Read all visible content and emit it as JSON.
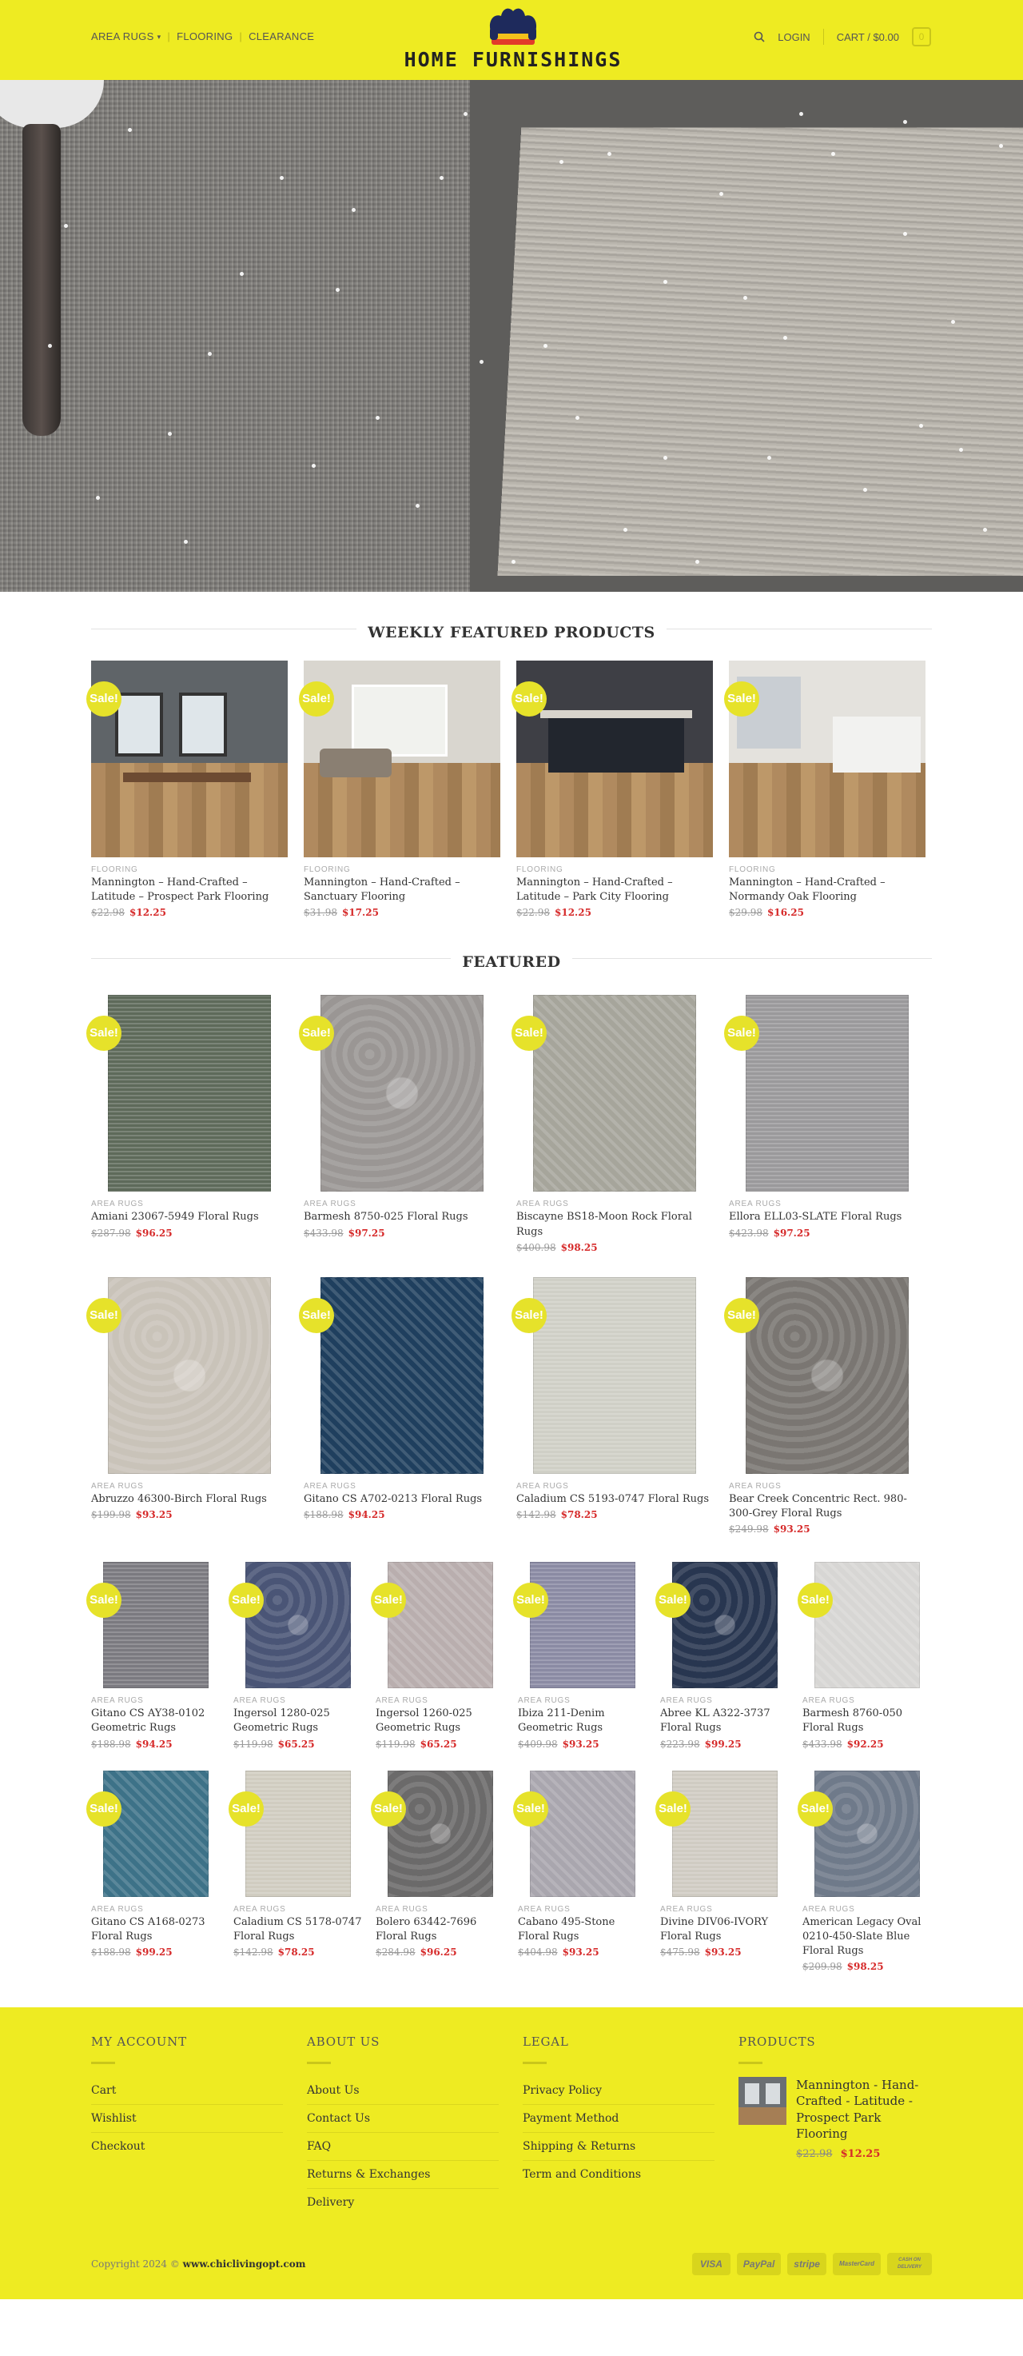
{
  "header": {
    "nav_left": [
      "AREA RUGS",
      "FLOORING",
      "CLEARANCE"
    ],
    "logo_text": "HOME FURNISHINGS",
    "login": "LOGIN",
    "cart": "CART / $0.00",
    "cart_count": "0"
  },
  "weekly": {
    "title": "WEEKLY FEATURED PRODUCTS",
    "items": [
      {
        "cat": "FLOORING",
        "name": "Mannington – Hand-Crafted – Latitude – Prospect Park Flooring",
        "old": "$22.98",
        "new": "$12.25",
        "sale": "Sale!"
      },
      {
        "cat": "FLOORING",
        "name": "Mannington – Hand-Crafted – Sanctuary Flooring",
        "old": "$31.98",
        "new": "$17.25",
        "sale": "Sale!"
      },
      {
        "cat": "FLOORING",
        "name": "Mannington – Hand-Crafted – Latitude – Park City Flooring",
        "old": "$22.98",
        "new": "$12.25",
        "sale": "Sale!"
      },
      {
        "cat": "FLOORING",
        "name": "Mannington – Hand-Crafted – Normandy Oak Flooring",
        "old": "$29.98",
        "new": "$16.25",
        "sale": "Sale!"
      }
    ]
  },
  "featured": {
    "title": "FEATURED",
    "row1": [
      {
        "cat": "AREA RUGS",
        "name": "Amiani 23067-5949 Floral Rugs",
        "old": "$287.98",
        "new": "$96.25",
        "sale": "Sale!",
        "color": "#5e6a5a"
      },
      {
        "cat": "AREA RUGS",
        "name": "Barmesh 8750-025 Floral Rugs",
        "old": "$433.98",
        "new": "$97.25",
        "sale": "Sale!",
        "color": "#9a9694"
      },
      {
        "cat": "AREA RUGS",
        "name": "Biscayne BS18-Moon Rock Floral Rugs",
        "old": "$400.98",
        "new": "$98.25",
        "sale": "Sale!",
        "color": "#a6a59b"
      },
      {
        "cat": "AREA RUGS",
        "name": "Ellora ELL03-SLATE Floral Rugs",
        "old": "$423.98",
        "new": "$97.25",
        "sale": "Sale!",
        "color": "#9a999b"
      }
    ],
    "row2": [
      {
        "cat": "AREA RUGS",
        "name": "Abruzzo 46300-Birch Floral Rugs",
        "old": "$199.98",
        "new": "$93.25",
        "sale": "Sale!",
        "color": "#c9c3b9"
      },
      {
        "cat": "AREA RUGS",
        "name": "Gitano CS A702-0213 Floral Rugs",
        "old": "$188.98",
        "new": "$94.25",
        "sale": "Sale!",
        "color": "#1f3f5e"
      },
      {
        "cat": "AREA RUGS",
        "name": "Caladium CS 5193-0747 Floral Rugs",
        "old": "$142.98",
        "new": "$78.25",
        "sale": "Sale!",
        "color": "#cfcfc6"
      },
      {
        "cat": "AREA RUGS",
        "name": "Bear Creek Concentric Rect. 980-300-Grey Floral Rugs",
        "old": "$249.98",
        "new": "$93.25",
        "sale": "Sale!",
        "color": "#7a7672"
      }
    ],
    "row3": [
      {
        "cat": "AREA RUGS",
        "name": "Gitano CS AY38-0102 Geometric Rugs",
        "old": "$188.98",
        "new": "$94.25",
        "sale": "Sale!",
        "color": "#7b7a80"
      },
      {
        "cat": "AREA RUGS",
        "name": "Ingersol 1280-025 Geometric Rugs",
        "old": "$119.98",
        "new": "$65.25",
        "sale": "Sale!",
        "color": "#4a5576"
      },
      {
        "cat": "AREA RUGS",
        "name": "Ingersol 1260-025 Geometric Rugs",
        "old": "$119.98",
        "new": "$65.25",
        "sale": "Sale!",
        "color": "#b9aeae"
      },
      {
        "cat": "AREA RUGS",
        "name": "Ibiza 211-Denim Geometric Rugs",
        "old": "$409.98",
        "new": "$93.25",
        "sale": "Sale!",
        "color": "#8a8aa3"
      },
      {
        "cat": "AREA RUGS",
        "name": "Abree KL A322-3737 Floral Rugs",
        "old": "$223.98",
        "new": "$99.25",
        "sale": "Sale!",
        "color": "#283650"
      },
      {
        "cat": "AREA RUGS",
        "name": "Barmesh 8760-050 Floral Rugs",
        "old": "$433.98",
        "new": "$92.25",
        "sale": "Sale!",
        "color": "#d7d6d4"
      }
    ],
    "row4": [
      {
        "cat": "AREA RUGS",
        "name": "Gitano CS A168-0273 Floral Rugs",
        "old": "$188.98",
        "new": "$99.25",
        "sale": "Sale!",
        "color": "#3d7288"
      },
      {
        "cat": "AREA RUGS",
        "name": "Caladium CS 5178-0747 Floral Rugs",
        "old": "$142.98",
        "new": "$78.25",
        "sale": "Sale!",
        "color": "#d0ccc0"
      },
      {
        "cat": "AREA RUGS",
        "name": "Bolero 63442-7696 Floral Rugs",
        "old": "$284.98",
        "new": "$96.25",
        "sale": "Sale!",
        "color": "#6b6a6a"
      },
      {
        "cat": "AREA RUGS",
        "name": "Cabano 495-Stone Floral Rugs",
        "old": "$404.98",
        "new": "$93.25",
        "sale": "Sale!",
        "color": "#a9a6ae"
      },
      {
        "cat": "AREA RUGS",
        "name": "Divine DIV06-IVORY Floral Rugs",
        "old": "$475.98",
        "new": "$93.25",
        "sale": "Sale!",
        "color": "#cfcbc2"
      },
      {
        "cat": "AREA RUGS",
        "name": "American Legacy Oval 0210-450-Slate Blue Floral Rugs",
        "old": "$209.98",
        "new": "$98.25",
        "sale": "Sale!",
        "color": "#6f7a8a"
      }
    ]
  },
  "footer": {
    "account_title": "MY ACCOUNT",
    "account_links": [
      "Cart",
      "Wishlist",
      "Checkout"
    ],
    "about_title": "ABOUT US",
    "about_links": [
      "About Us",
      "Contact Us",
      "FAQ",
      "Returns & Exchanges",
      "Delivery"
    ],
    "legal_title": "LEGAL",
    "legal_links": [
      "Privacy Policy",
      "Payment Method",
      "Shipping & Returns",
      "Term and Conditions"
    ],
    "products_title": "PRODUCTS",
    "product": {
      "name": "Mannington - Hand-Crafted - Latitude - Prospect Park Flooring",
      "old": "$22.98",
      "new": "$12.25"
    },
    "copyright_prefix": "Copyright 2024 ©",
    "copyright_site": "www.chiclivingopt.com",
    "payments": [
      "VISA",
      "PayPal",
      "stripe",
      "MasterCard",
      "CASH ON DELIVERY"
    ]
  },
  "colors": {
    "accent": "#eeeb22",
    "sale_badge": "#e6e22a",
    "price_new": "#d62a2a"
  }
}
